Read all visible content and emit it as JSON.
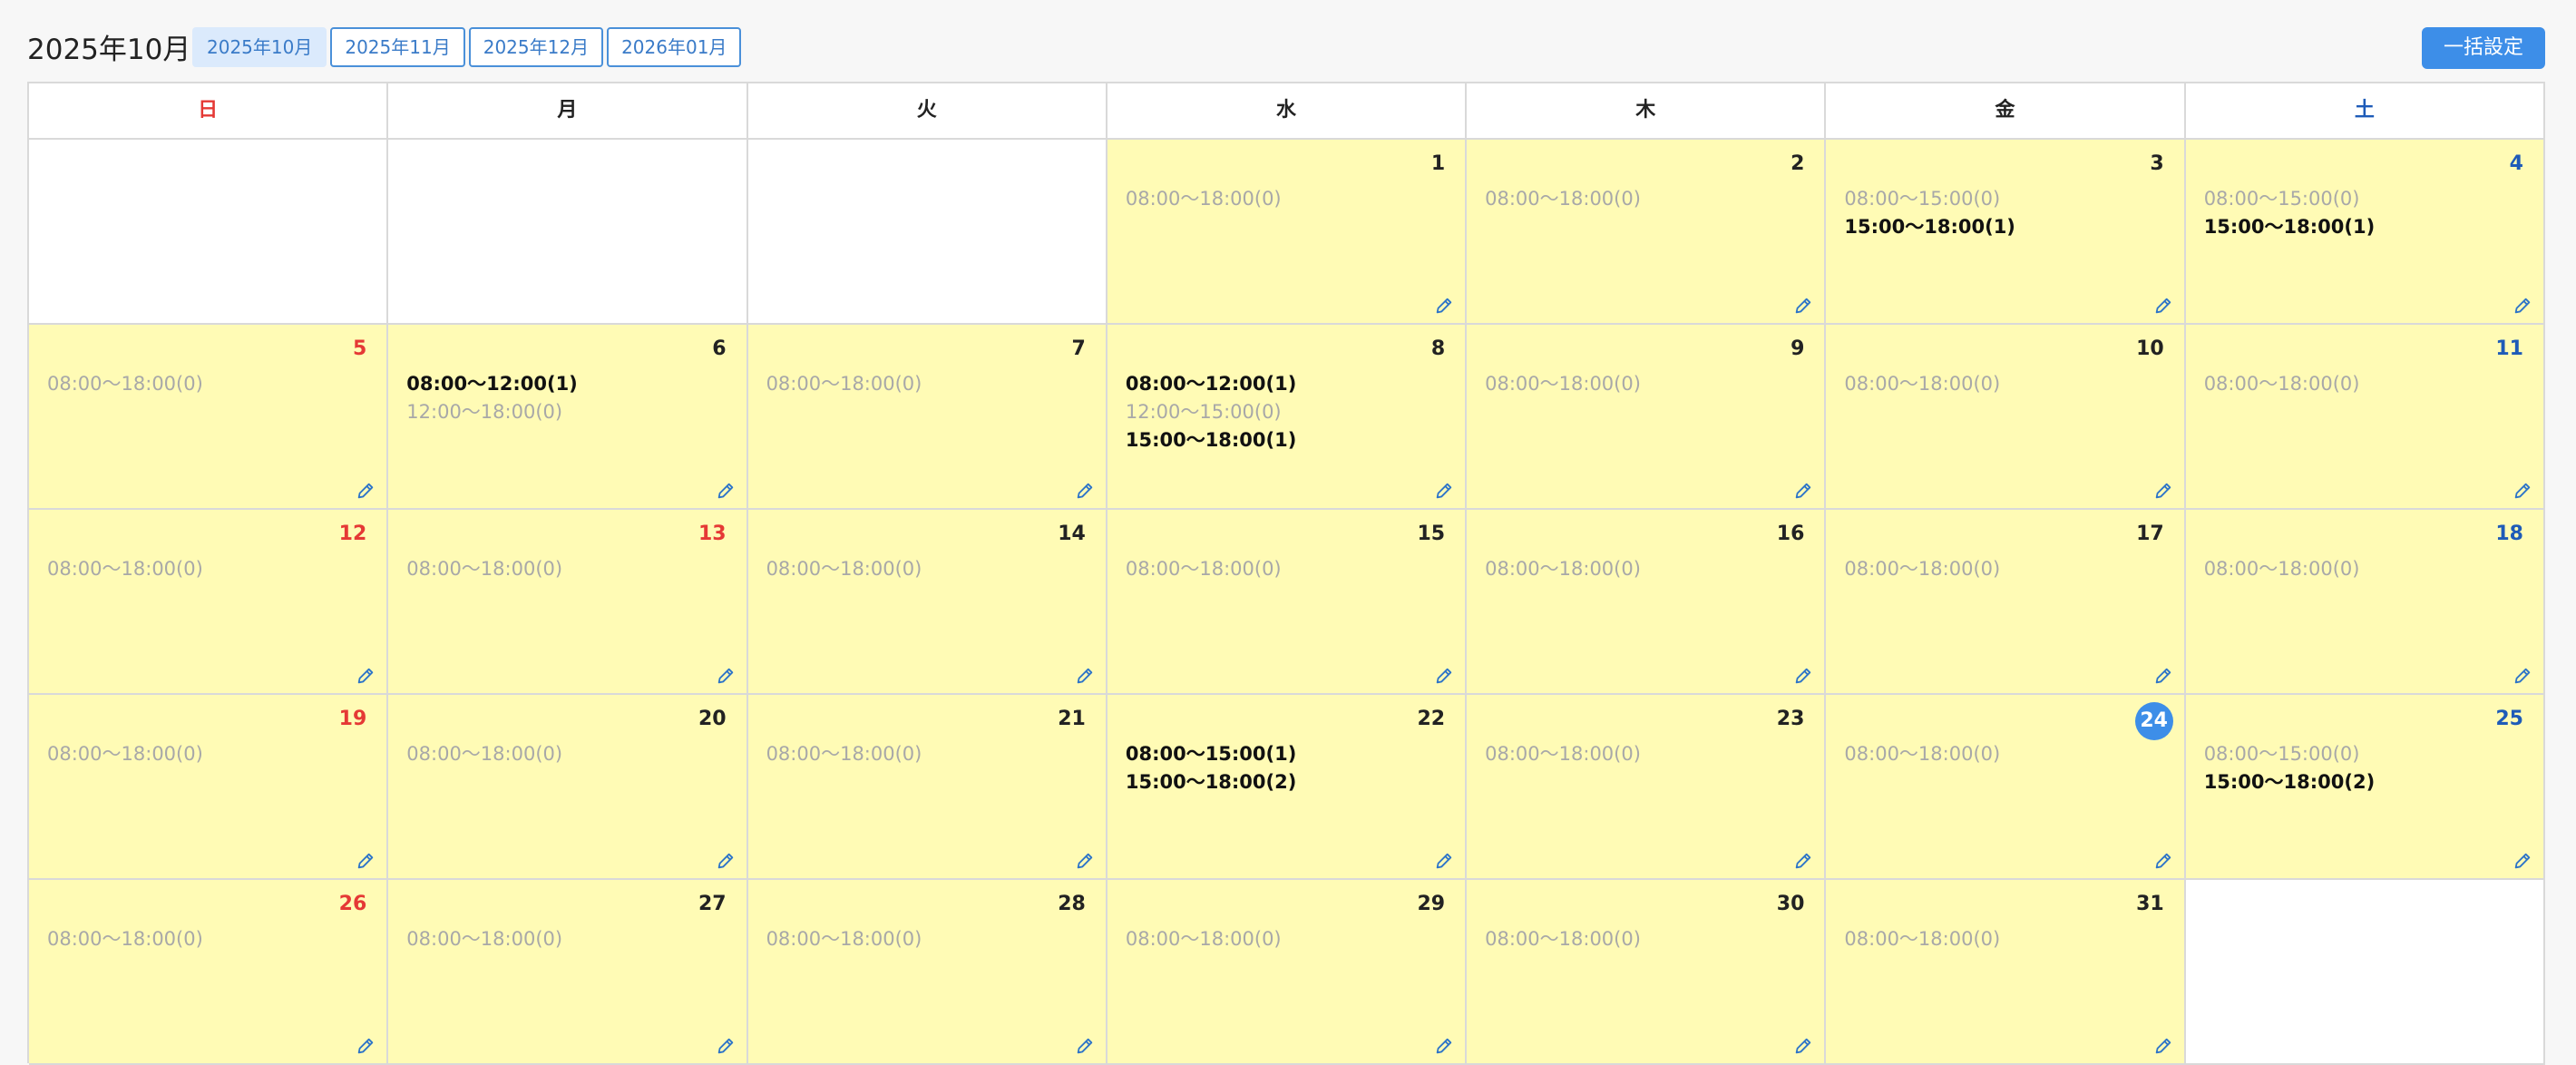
{
  "header": {
    "title": "2025年10月",
    "tabs": [
      {
        "label": "2025年10月",
        "active": true
      },
      {
        "label": "2025年11月",
        "active": false
      },
      {
        "label": "2025年12月",
        "active": false
      },
      {
        "label": "2026年01月",
        "active": false
      }
    ],
    "bulk_button": "一括設定"
  },
  "weekdays": [
    "日",
    "月",
    "火",
    "水",
    "木",
    "金",
    "土"
  ],
  "colors": {
    "sunday": "#e53935",
    "saturday": "#1e5bb8",
    "accent": "#3d8ee8",
    "day_fill": "#fffbb5"
  },
  "weeks": [
    [
      null,
      null,
      null,
      {
        "day": "1",
        "slots": [
          {
            "text": "08:00〜18:00(0)",
            "booked": false
          }
        ]
      },
      {
        "day": "2",
        "slots": [
          {
            "text": "08:00〜18:00(0)",
            "booked": false
          }
        ]
      },
      {
        "day": "3",
        "slots": [
          {
            "text": "08:00〜15:00(0)",
            "booked": false
          },
          {
            "text": "15:00〜18:00(1)",
            "booked": true
          }
        ]
      },
      {
        "day": "4",
        "slots": [
          {
            "text": "08:00〜15:00(0)",
            "booked": false
          },
          {
            "text": "15:00〜18:00(1)",
            "booked": true
          }
        ]
      }
    ],
    [
      {
        "day": "5",
        "slots": [
          {
            "text": "08:00〜18:00(0)",
            "booked": false
          }
        ]
      },
      {
        "day": "6",
        "slots": [
          {
            "text": "08:00〜12:00(1)",
            "booked": true
          },
          {
            "text": "12:00〜18:00(0)",
            "booked": false
          }
        ]
      },
      {
        "day": "7",
        "slots": [
          {
            "text": "08:00〜18:00(0)",
            "booked": false
          }
        ]
      },
      {
        "day": "8",
        "slots": [
          {
            "text": "08:00〜12:00(1)",
            "booked": true
          },
          {
            "text": "12:00〜15:00(0)",
            "booked": false
          },
          {
            "text": "15:00〜18:00(1)",
            "booked": true
          }
        ]
      },
      {
        "day": "9",
        "slots": [
          {
            "text": "08:00〜18:00(0)",
            "booked": false
          }
        ]
      },
      {
        "day": "10",
        "slots": [
          {
            "text": "08:00〜18:00(0)",
            "booked": false
          }
        ]
      },
      {
        "day": "11",
        "slots": [
          {
            "text": "08:00〜18:00(0)",
            "booked": false
          }
        ]
      }
    ],
    [
      {
        "day": "12",
        "slots": [
          {
            "text": "08:00〜18:00(0)",
            "booked": false
          }
        ]
      },
      {
        "day": "13",
        "holiday": true,
        "slots": [
          {
            "text": "08:00〜18:00(0)",
            "booked": false
          }
        ]
      },
      {
        "day": "14",
        "slots": [
          {
            "text": "08:00〜18:00(0)",
            "booked": false
          }
        ]
      },
      {
        "day": "15",
        "slots": [
          {
            "text": "08:00〜18:00(0)",
            "booked": false
          }
        ]
      },
      {
        "day": "16",
        "slots": [
          {
            "text": "08:00〜18:00(0)",
            "booked": false
          }
        ]
      },
      {
        "day": "17",
        "slots": [
          {
            "text": "08:00〜18:00(0)",
            "booked": false
          }
        ]
      },
      {
        "day": "18",
        "slots": [
          {
            "text": "08:00〜18:00(0)",
            "booked": false
          }
        ]
      }
    ],
    [
      {
        "day": "19",
        "slots": [
          {
            "text": "08:00〜18:00(0)",
            "booked": false
          }
        ]
      },
      {
        "day": "20",
        "slots": [
          {
            "text": "08:00〜18:00(0)",
            "booked": false
          }
        ]
      },
      {
        "day": "21",
        "slots": [
          {
            "text": "08:00〜18:00(0)",
            "booked": false
          }
        ]
      },
      {
        "day": "22",
        "slots": [
          {
            "text": "08:00〜15:00(1)",
            "booked": true
          },
          {
            "text": "15:00〜18:00(2)",
            "booked": true
          }
        ]
      },
      {
        "day": "23",
        "slots": [
          {
            "text": "08:00〜18:00(0)",
            "booked": false
          }
        ]
      },
      {
        "day": "24",
        "today": true,
        "slots": [
          {
            "text": "08:00〜18:00(0)",
            "booked": false
          }
        ]
      },
      {
        "day": "25",
        "slots": [
          {
            "text": "08:00〜15:00(0)",
            "booked": false
          },
          {
            "text": "15:00〜18:00(2)",
            "booked": true
          }
        ]
      }
    ],
    [
      {
        "day": "26",
        "slots": [
          {
            "text": "08:00〜18:00(0)",
            "booked": false
          }
        ]
      },
      {
        "day": "27",
        "slots": [
          {
            "text": "08:00〜18:00(0)",
            "booked": false
          }
        ]
      },
      {
        "day": "28",
        "slots": [
          {
            "text": "08:00〜18:00(0)",
            "booked": false
          }
        ]
      },
      {
        "day": "29",
        "slots": [
          {
            "text": "08:00〜18:00(0)",
            "booked": false
          }
        ]
      },
      {
        "day": "30",
        "slots": [
          {
            "text": "08:00〜18:00(0)",
            "booked": false
          }
        ]
      },
      {
        "day": "31",
        "slots": [
          {
            "text": "08:00〜18:00(0)",
            "booked": false
          }
        ]
      },
      null
    ]
  ],
  "icons": {
    "edit": "pencil-icon"
  }
}
